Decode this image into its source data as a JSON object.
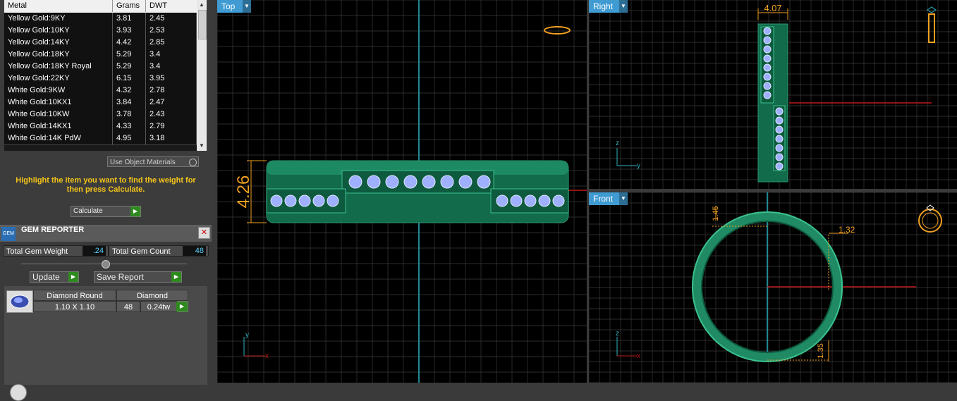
{
  "metal_table": {
    "headers": [
      "Metal",
      "Grams",
      "DWT"
    ],
    "rows": [
      [
        "Yellow Gold:9KY",
        "3.81",
        "2.45"
      ],
      [
        "Yellow Gold:10KY",
        "3.93",
        "2.53"
      ],
      [
        "Yellow Gold:14KY",
        "4.42",
        "2.85"
      ],
      [
        "Yellow Gold:18KY",
        "5.29",
        "3.4"
      ],
      [
        "Yellow Gold:18KY Royal",
        "5.29",
        "3.4"
      ],
      [
        "Yellow Gold:22KY",
        "6.15",
        "3.95"
      ],
      [
        "White Gold:9KW",
        "4.32",
        "2.78"
      ],
      [
        "White Gold:10KX1",
        "3.84",
        "2.47"
      ],
      [
        "White Gold:10KW",
        "3.78",
        "2.43"
      ],
      [
        "White Gold:14KX1",
        "4.33",
        "2.79"
      ],
      [
        "White Gold:14K PdW",
        "4.95",
        "3.18"
      ]
    ]
  },
  "use_object_materials": "Use Object Materials",
  "hint": "Highlight the item you want to find the weight for then press Calculate.",
  "calculate_label": "Calculate",
  "gem_reporter": {
    "title": "GEM REPORTER",
    "logo_text": "GEM",
    "total_weight_label": "Total Gem Weight",
    "total_weight_value": ".24",
    "total_count_label": "Total Gem Count",
    "total_count_value": "48",
    "update_label": "Update",
    "save_report_label": "Save Report",
    "gem": {
      "shape": "Diamond Round",
      "size": "1.10 X 1.10",
      "type": "Diamond",
      "count": "48",
      "weight": "0.24tw"
    }
  },
  "viewports": {
    "top": {
      "label": "Top",
      "dimension": "4.26"
    },
    "right": {
      "label": "Right",
      "dimension": "4.07"
    },
    "front": {
      "label": "Front",
      "dim_a": "1.45",
      "dim_b": "1.32",
      "dim_c": "1.35"
    }
  },
  "axis_labels": {
    "x": "x",
    "y": "y",
    "z": "z"
  },
  "colors": {
    "accent": "#3f9bd2",
    "ring": "#1f8a63",
    "hint": "#f5c518",
    "dimension": "#f0a020",
    "go": "#2f8a1f"
  }
}
